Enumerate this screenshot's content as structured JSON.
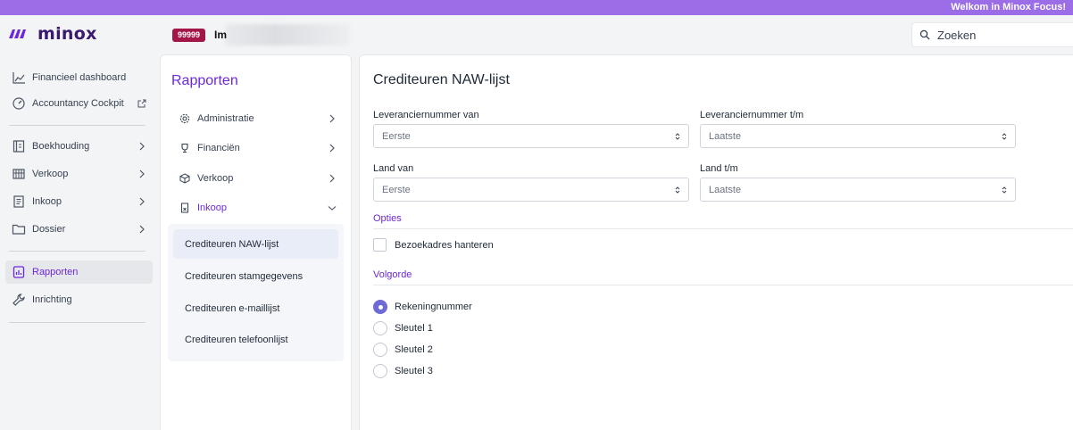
{
  "topbar": {
    "welcome": "Welkom in Minox Focus!"
  },
  "brand": {
    "name": "minox",
    "accent": "#6d28d9"
  },
  "administration": {
    "badge": "99999",
    "name_visible": "Im"
  },
  "search": {
    "label": "Zoeken",
    "icon": "search-icon"
  },
  "nav": {
    "items": [
      {
        "label": "Financieel dashboard",
        "icon": "chart-icon"
      },
      {
        "label": "Accountancy Cockpit",
        "icon": "gauge-icon",
        "external": true
      },
      {
        "label": "Boekhouding",
        "icon": "ledger-icon",
        "has_children": true
      },
      {
        "label": "Verkoop",
        "icon": "register-icon",
        "has_children": true
      },
      {
        "label": "Inkoop",
        "icon": "invoice-icon",
        "has_children": true
      },
      {
        "label": "Dossier",
        "icon": "folder-icon",
        "has_children": true
      },
      {
        "label": "Rapporten",
        "icon": "report-icon",
        "active": true
      },
      {
        "label": "Inrichting",
        "icon": "wrench-icon"
      }
    ]
  },
  "reports_panel": {
    "title": "Rapporten",
    "categories": [
      {
        "label": "Administratie",
        "icon": "gear-icon"
      },
      {
        "label": "Financiën",
        "icon": "trophy-icon"
      },
      {
        "label": "Verkoop",
        "icon": "box-icon"
      },
      {
        "label": "Inkoop",
        "icon": "doc-icon",
        "expanded": true
      }
    ],
    "sub_items": [
      {
        "label": "Crediteuren NAW-lijst",
        "active": true
      },
      {
        "label": "Crediteuren stamgegevens"
      },
      {
        "label": "Crediteuren e-maillijst"
      },
      {
        "label": "Crediteuren telefoonlijst"
      }
    ]
  },
  "report": {
    "title": "Crediteuren NAW-lijst",
    "fields": [
      {
        "label": "Leveranciernummer van",
        "value": "Eerste"
      },
      {
        "label": "Leveranciernummer t/m",
        "value": "Laatste"
      },
      {
        "label": "Land van",
        "value": "Eerste"
      },
      {
        "label": "Land t/m",
        "value": "Laatste"
      }
    ],
    "options_title": "Opties",
    "checkbox": {
      "label": "Bezoekadres hanteren",
      "checked": false
    },
    "order_title": "Volgorde",
    "order_options": [
      {
        "label": "Rekeningnummer",
        "checked": true
      },
      {
        "label": "Sleutel 1",
        "checked": false
      },
      {
        "label": "Sleutel 2",
        "checked": false
      },
      {
        "label": "Sleutel 3",
        "checked": false
      }
    ]
  }
}
